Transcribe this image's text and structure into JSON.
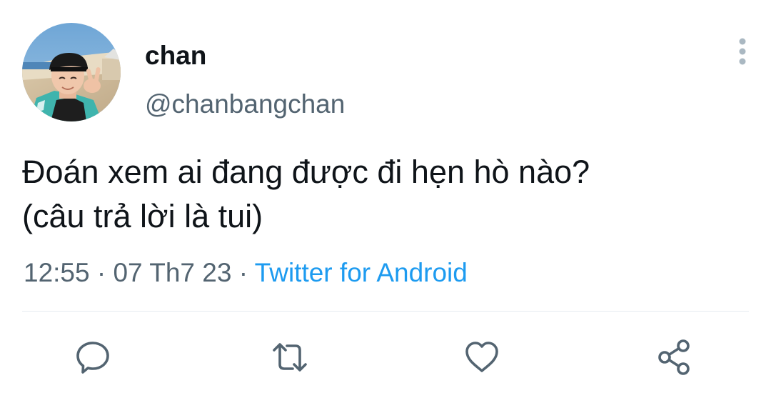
{
  "user": {
    "display_name": "chan",
    "handle": "@chanbangchan"
  },
  "tweet": {
    "lines": [
      "Đoán xem ai đang được đi hẹn hò nào?",
      "(câu trả lời là tui)"
    ],
    "time": "12:55",
    "separator": " · ",
    "date": "07 Th7 23",
    "source": "Twitter for Android"
  },
  "actions": [
    {
      "icon": "reply-icon"
    },
    {
      "icon": "retweet-icon"
    },
    {
      "icon": "like-icon"
    },
    {
      "icon": "share-icon"
    }
  ],
  "colors": {
    "text": "#0f1419",
    "secondary": "#536471",
    "link": "#1d9bf0",
    "icon": "#536471",
    "divider": "#e6ecf0"
  }
}
